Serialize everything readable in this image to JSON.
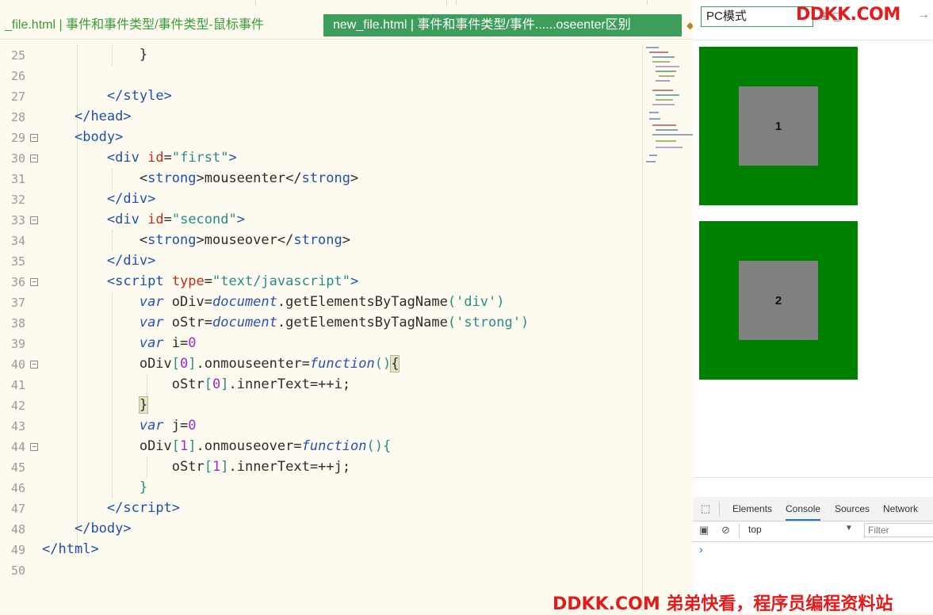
{
  "editor": {
    "tabs": [
      {
        "label": "_file.html | 事件和事件类型/事件类型-鼠标事件",
        "active": false
      },
      {
        "label": "new_file.html | 事件和事件类型/事件......oseenter区别",
        "active": true
      }
    ],
    "lines": [
      {
        "n": "25"
      },
      {
        "n": "26"
      },
      {
        "n": "27"
      },
      {
        "n": "28"
      },
      {
        "n": "29"
      },
      {
        "n": "30"
      },
      {
        "n": "31"
      },
      {
        "n": "32"
      },
      {
        "n": "33"
      },
      {
        "n": "34"
      },
      {
        "n": "35"
      },
      {
        "n": "36"
      },
      {
        "n": "37"
      },
      {
        "n": "38"
      },
      {
        "n": "39"
      },
      {
        "n": "40"
      },
      {
        "n": "41"
      },
      {
        "n": "42"
      },
      {
        "n": "43"
      },
      {
        "n": "44"
      },
      {
        "n": "45"
      },
      {
        "n": "46"
      },
      {
        "n": "47"
      },
      {
        "n": "48"
      },
      {
        "n": "49"
      },
      {
        "n": "50"
      }
    ],
    "code": {
      "div_tag": "div",
      "strong_tag": "strong",
      "script_tag": "script",
      "style_tag": "style",
      "head_tag": "head",
      "body_tag": "body",
      "html_tag": "html",
      "id_attr": "id",
      "type_attr": "type",
      "first_id": "\"first\"",
      "second_id": "\"second\"",
      "type_val": "\"text/javascript\"",
      "text_mouseenter": "mouseenter",
      "text_mouseover": "mouseover",
      "kw_var": "var",
      "kw_function": "function",
      "obj_document": "document",
      "v_oDiv": "oDiv",
      "v_oStr": "oStr",
      "v_i": "i",
      "v_j": "j",
      "method_get": "getElementsByTagName",
      "str_div": "'div'",
      "str_strong": "'strong'",
      "num_0": "0",
      "num_1": "1",
      "prop_onmouseenter": "onmouseenter",
      "prop_onmouseover": "onmouseover",
      "prop_innerText": "innerText",
      "op_incr": "++",
      "brace_close": "}"
    }
  },
  "browser": {
    "mode_label": "PC模式",
    "boxes": [
      {
        "label": "1"
      },
      {
        "label": "2"
      }
    ]
  },
  "devtools": {
    "tabs": [
      "Elements",
      "Console",
      "Sources",
      "Network"
    ],
    "active_tab": "Console",
    "context": "top",
    "filter_placeholder": "Filter",
    "prompt": "›"
  },
  "watermarks": {
    "top": "DDKK.COM",
    "bottom": "DDKK.COM 弟弟快看，程序员编程资料站"
  },
  "colors": {
    "tab_active_bg": "#3c9e5a",
    "box_green": "#008000",
    "box_gray": "#808080",
    "watermark_red": "#e31b1b",
    "console_blue": "#1a73e8"
  }
}
